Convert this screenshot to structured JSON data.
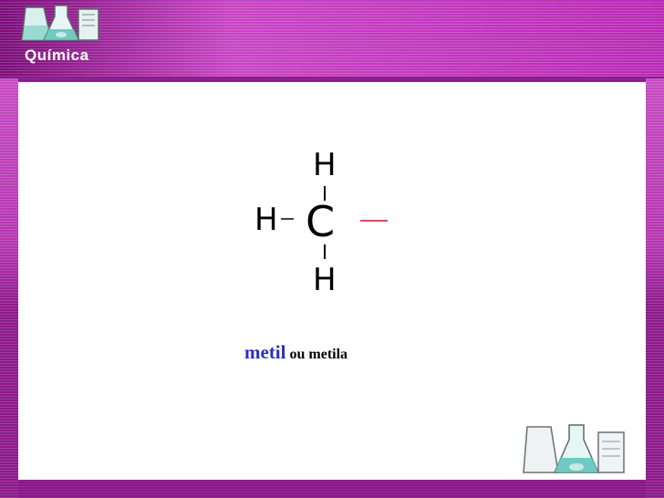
{
  "header": {
    "subject_label": "Química",
    "logo_icon": "lab-glassware-icon"
  },
  "molecule": {
    "central_atom": "C",
    "top_atom": "H",
    "left_atom": "H",
    "bottom_atom": "H",
    "free_valence_color": "#c8102e"
  },
  "caption": {
    "name": "metil",
    "alternative": "ou metila",
    "name_color": "#2b2fc0"
  },
  "colors": {
    "background": "#8a1688",
    "band_light": "#c845c4",
    "slide": "#ffffff"
  },
  "footer": {
    "logo_icon": "lab-glassware-icon"
  }
}
